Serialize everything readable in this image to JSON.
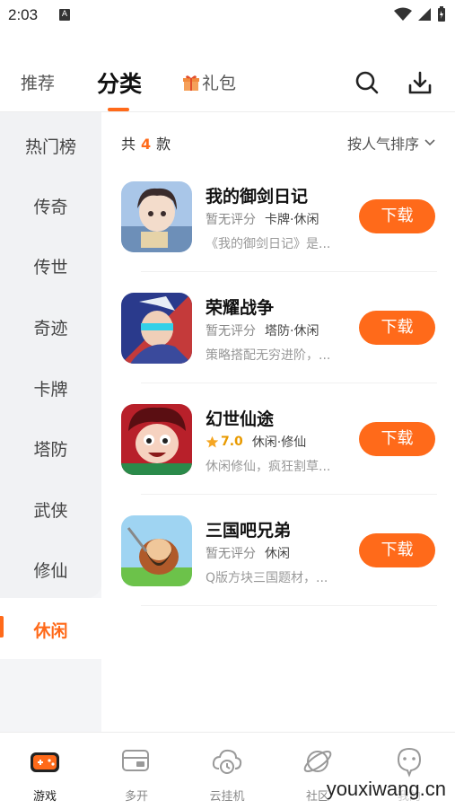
{
  "status_bar": {
    "time": "2:03",
    "notif_glyph": "A"
  },
  "top_tabs": {
    "recommend": "推荐",
    "category": "分类",
    "gift": "礼包"
  },
  "sidebar": {
    "items": [
      "热门榜",
      "传奇",
      "传世",
      "奇迹",
      "卡牌",
      "塔防",
      "武侠",
      "修仙",
      "休闲"
    ],
    "active": "休闲"
  },
  "list_header": {
    "count_prefix": "共",
    "count": "4",
    "count_suffix": "款",
    "sort_label": "按人气排序"
  },
  "games": [
    {
      "name": "我的御剑日记",
      "rating": "暂无评分",
      "tags": "卡牌·休闲",
      "desc": "《我的御剑日记》是...",
      "button": "下载"
    },
    {
      "name": "荣耀战争",
      "rating": "暂无评分",
      "tags": "塔防·休闲",
      "desc": "策略搭配无穷进阶，...",
      "button": "下载"
    },
    {
      "name": "幻世仙途",
      "rating": "7.0",
      "tags": "休闲·修仙",
      "desc": "休闲修仙，疯狂割草...",
      "button": "下载"
    },
    {
      "name": "三国吧兄弟",
      "rating": "暂无评分",
      "tags": "休闲",
      "desc": "Q版方块三国题材，...",
      "button": "下载"
    }
  ],
  "bottom_nav": {
    "items": [
      {
        "label": "游戏",
        "icon": "gamepad-icon"
      },
      {
        "label": "多开",
        "icon": "multi-window-icon"
      },
      {
        "label": "云挂机",
        "icon": "cloud-clock-icon"
      },
      {
        "label": "社区",
        "icon": "planet-icon"
      },
      {
        "label": "我的",
        "icon": "profile-icon"
      }
    ]
  },
  "watermark": "youxiwang.cn",
  "colors": {
    "accent": "#ff6a1a",
    "rating_star": "#f5a623"
  }
}
